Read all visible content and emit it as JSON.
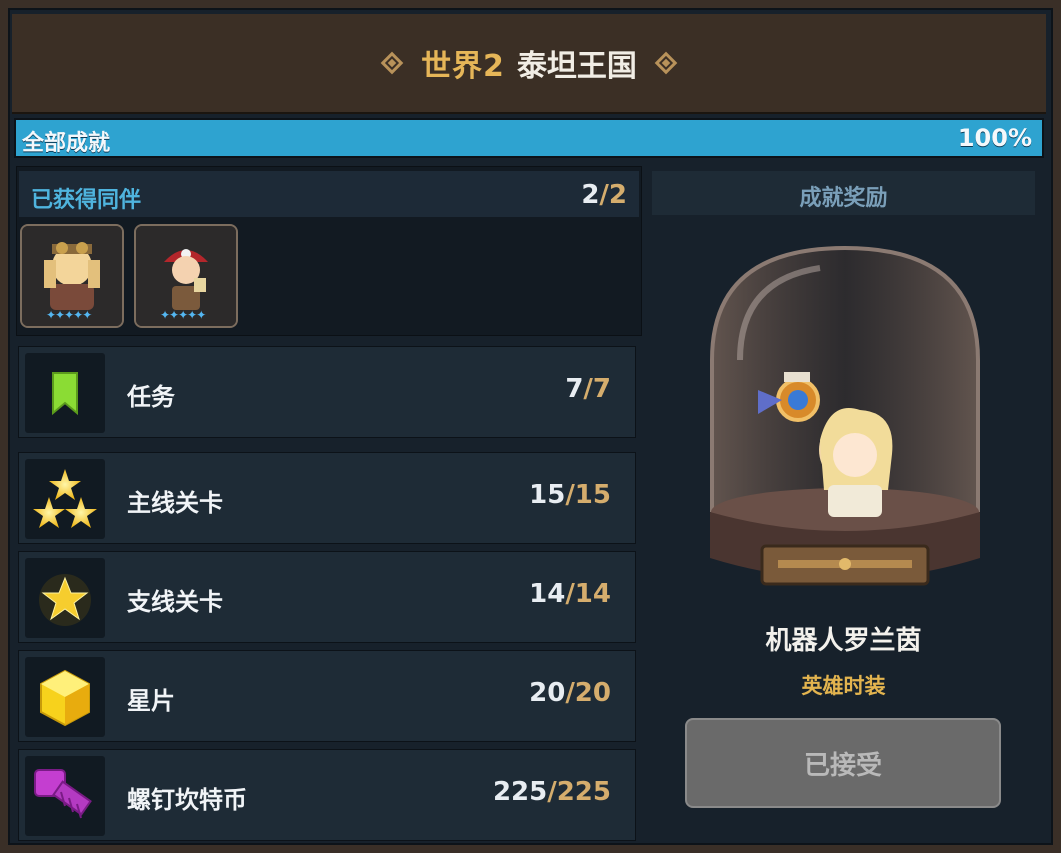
{
  "header": {
    "world": "世界2",
    "name": "泰坦王国"
  },
  "progress": {
    "label": "全部成就",
    "value": "100%",
    "fraction": 1.0
  },
  "companions": {
    "label": "已获得同伴",
    "count_current": "2",
    "count_sep": "/2",
    "cards": [
      {
        "name": "companion-1",
        "pips": "✦✦✦✦✦"
      },
      {
        "name": "companion-2",
        "pips": "✦✦✦✦✦"
      }
    ]
  },
  "achievements": [
    {
      "label": "任务",
      "current": "7",
      "total": "/7",
      "icon": "bookmark-icon"
    },
    {
      "label": "主线关卡",
      "current": "15",
      "total": "/15",
      "icon": "three-stars-icon"
    },
    {
      "label": "支线关卡",
      "current": "14",
      "total": "/14",
      "icon": "star-icon"
    },
    {
      "label": "星片",
      "current": "20",
      "total": "/20",
      "icon": "star-piece-cube-icon"
    },
    {
      "label": "螺钉坎特币",
      "current": "225",
      "total": "/225",
      "icon": "screw-coin-icon"
    }
  ],
  "reward": {
    "header": "成就奖励",
    "name": "机器人罗兰茵",
    "type": "英雄时装",
    "button": "已接受"
  },
  "colors": {
    "accent": "#2ea3d0",
    "gold": "#d5ad6d",
    "title_gold": "#e6b658"
  }
}
